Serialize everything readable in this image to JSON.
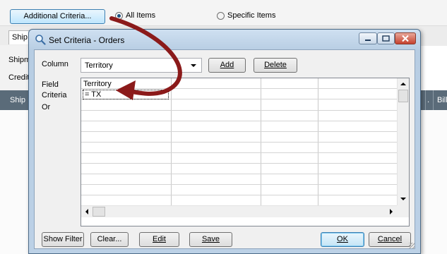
{
  "toolbar": {
    "additional_criteria_label": "Additional Criteria...",
    "all_items_label": "All Items",
    "specific_items_label": "Specific Items",
    "all_items_checked": true,
    "specific_items_checked": false
  },
  "background": {
    "tab_ship": "Ship",
    "label_shipm": "Shipm",
    "label_credit": "Credit",
    "column_ship": "Ship",
    "column_dot": ".",
    "column_bill": "Bill-"
  },
  "dialog": {
    "title": "Set Criteria - Orders",
    "column_label": "Column",
    "column_value": "Territory",
    "add_label": "Add",
    "delete_label": "Delete",
    "field_label": "Field",
    "criteria_label": "Criteria",
    "or_label": "Or",
    "grid": {
      "header_field": "Territory",
      "criteria_value": "= TX"
    },
    "buttons": {
      "show_filter": "Show Filter",
      "clear": "Clear...",
      "edit": "Edit",
      "save": "Save",
      "ok": "OK",
      "cancel": "Cancel"
    }
  },
  "icons": {
    "title_icon": "magnifier-icon",
    "minimize": "minimize-icon",
    "maximize": "maximize-icon",
    "close": "close-icon"
  },
  "colors": {
    "arrow": "#8b1a1a",
    "close_button": "#c5412e",
    "header_bar": "#5a6b79"
  }
}
